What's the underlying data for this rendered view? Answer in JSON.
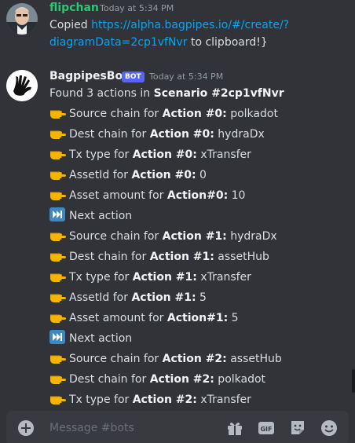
{
  "messages": [
    {
      "author": "flipchan",
      "timestamp": "Today at 5:34 PM",
      "text_prefix": "Copied ",
      "link_line1": "https://alpha.bagpipes.io/#/create/?",
      "link_line2": "diagramData=2cp1vfNvr",
      "text_suffix": " to clipboard!}"
    },
    {
      "author": "BagpipesBot",
      "badge": "BOT",
      "timestamp": "Today at 5:34 PM",
      "intro": "Found 3 actions in ",
      "intro_bold": "Scenario #2cp1vfNvr",
      "lines": [
        {
          "icon": "pointing-hand",
          "label": "Source chain for ",
          "bold": "Action #0:",
          "value": " polkadot"
        },
        {
          "icon": "pointing-hand",
          "label": "Dest chain for ",
          "bold": "Action #0:",
          "value": " hydraDx"
        },
        {
          "icon": "pointing-hand",
          "label": "Tx type for ",
          "bold": "Action #0:",
          "value": " xTransfer"
        },
        {
          "icon": "pointing-hand",
          "label": "AssetId for ",
          "bold": "Action #0:",
          "value": " 0"
        },
        {
          "icon": "pointing-hand",
          "label": "Asset amount for ",
          "bold": "Action#0:",
          "value": " 10"
        },
        {
          "icon": "next-track",
          "label": "Next action",
          "bold": "",
          "value": ""
        },
        {
          "icon": "pointing-hand",
          "label": "Source chain for ",
          "bold": "Action #1:",
          "value": " hydraDx"
        },
        {
          "icon": "pointing-hand",
          "label": "Dest chain for ",
          "bold": "Action #1:",
          "value": " assetHub"
        },
        {
          "icon": "pointing-hand",
          "label": "Tx type for ",
          "bold": "Action #1:",
          "value": " xTransfer"
        },
        {
          "icon": "pointing-hand",
          "label": "AssetId for ",
          "bold": "Action #1:",
          "value": " 5"
        },
        {
          "icon": "pointing-hand",
          "label": "Asset amount for ",
          "bold": "Action#1:",
          "value": " 5"
        },
        {
          "icon": "next-track",
          "label": "Next action",
          "bold": "",
          "value": ""
        },
        {
          "icon": "pointing-hand",
          "label": "Source chain for ",
          "bold": "Action #2:",
          "value": " assetHub"
        },
        {
          "icon": "pointing-hand",
          "label": "Dest chain for ",
          "bold": "Action #2:",
          "value": " polkadot"
        },
        {
          "icon": "pointing-hand",
          "label": "Tx type for ",
          "bold": "Action #2:",
          "value": " xTransfer"
        }
      ]
    }
  ],
  "composer": {
    "placeholder": "Message #bots",
    "icons": [
      "plus-circle-icon",
      "gift-icon",
      "gif-icon",
      "sticker-icon",
      "emoji-icon"
    ]
  },
  "colors": {
    "background": "#313338",
    "link": "#00a8fc",
    "bot_badge": "#5865f2",
    "flipchan_name": "#2dc770",
    "bot_name": "#f2f3f5"
  }
}
